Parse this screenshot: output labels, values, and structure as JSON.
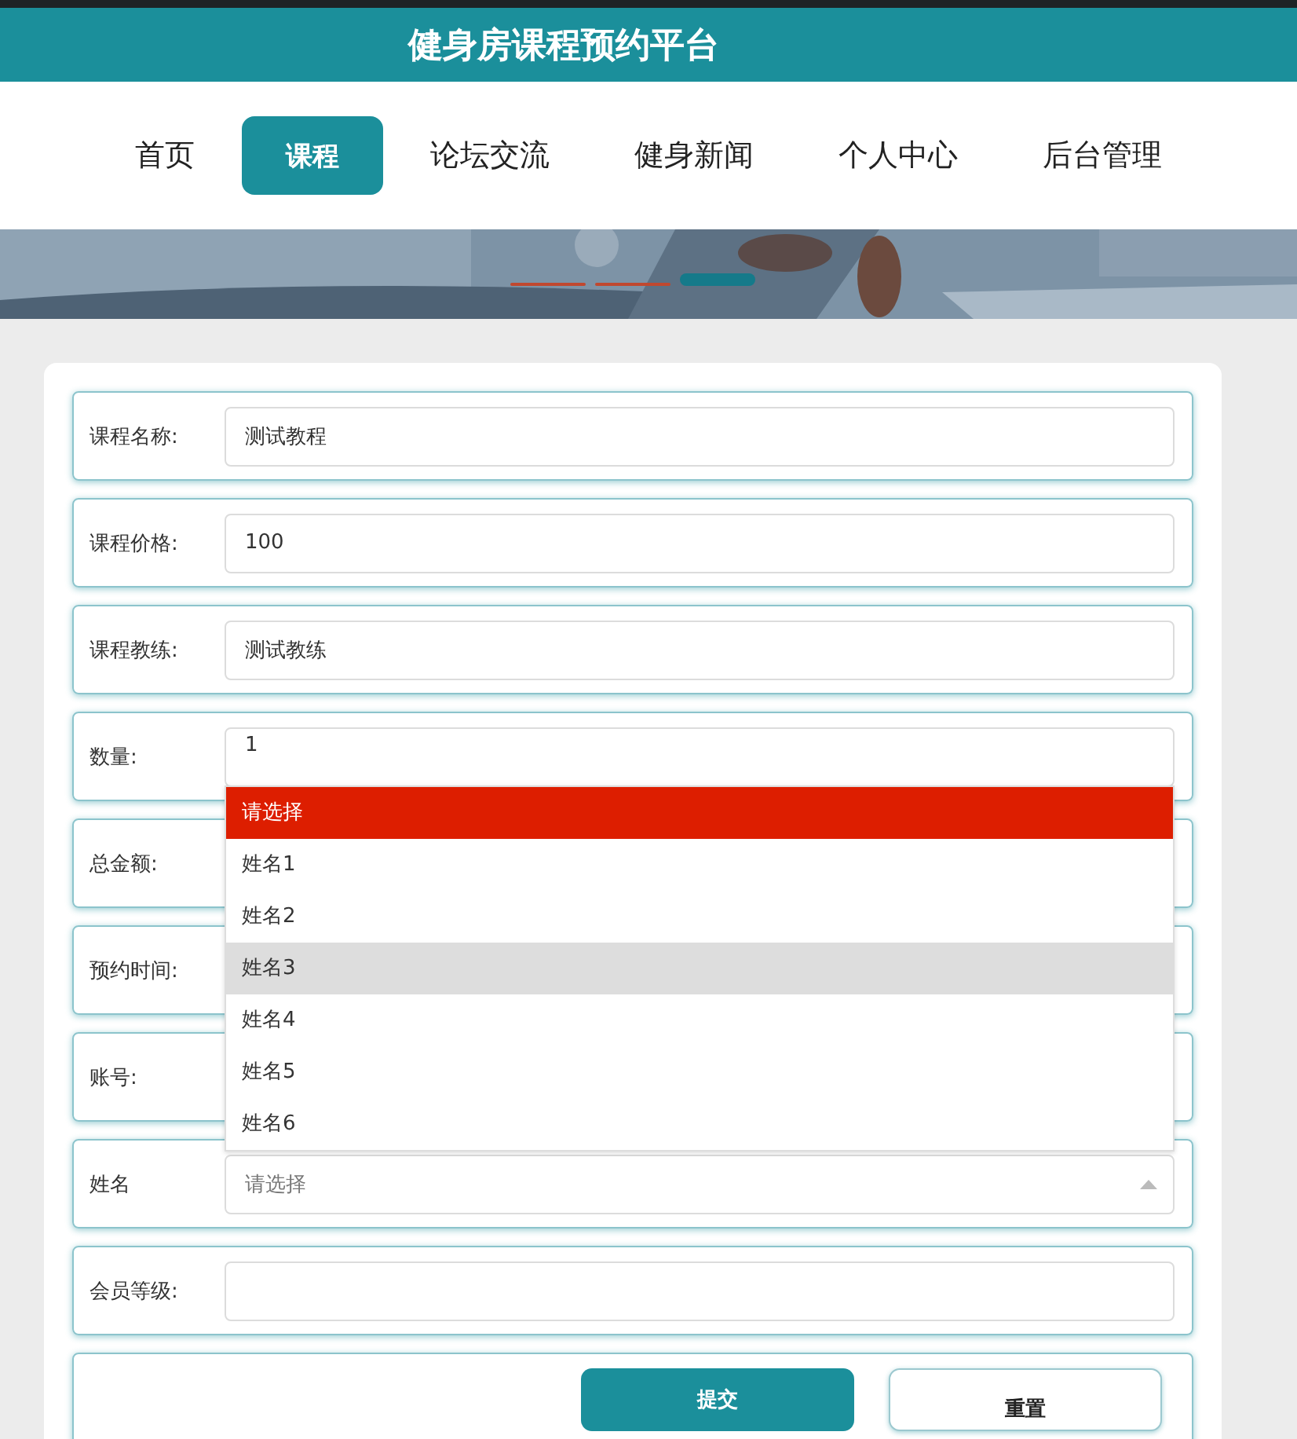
{
  "header": {
    "title": "健身房课程预约平台"
  },
  "nav": [
    {
      "label": "首页",
      "selected": false
    },
    {
      "label": "课程",
      "selected": true
    },
    {
      "label": "论坛交流",
      "selected": false
    },
    {
      "label": "健身新闻",
      "selected": false
    },
    {
      "label": "个人中心",
      "selected": false
    },
    {
      "label": "后台管理",
      "selected": false
    }
  ],
  "banner": {
    "kind": "picture",
    "indicators": [
      {
        "selected": false
      },
      {
        "selected": false
      },
      {
        "selected": true
      }
    ]
  },
  "form": {
    "fields": [
      {
        "kind": "text",
        "label": "课程名称:",
        "value": "测试教程"
      },
      {
        "kind": "text",
        "label": "课程价格:",
        "value": "100"
      },
      {
        "kind": "text",
        "label": "课程教练:",
        "value": "测试教练"
      },
      {
        "kind": "text",
        "label": "数量:",
        "value": "1"
      },
      {
        "kind": "label",
        "label": "总金额:"
      },
      {
        "kind": "label",
        "label": "预约时间:"
      },
      {
        "kind": "label",
        "label": "账号:"
      },
      {
        "kind": "select",
        "label": "姓名",
        "placeholder": "请选择",
        "expanded": true,
        "options": [
          {
            "label": "请选择",
            "selected": true,
            "hovered": false
          },
          {
            "label": "姓名1",
            "selected": false,
            "hovered": false
          },
          {
            "label": "姓名2",
            "selected": false,
            "hovered": false
          },
          {
            "label": "姓名3",
            "selected": false,
            "hovered": true
          },
          {
            "label": "姓名4",
            "selected": false,
            "hovered": false
          },
          {
            "label": "姓名5",
            "selected": false,
            "hovered": false
          },
          {
            "label": "姓名6",
            "selected": false,
            "hovered": false
          }
        ]
      },
      {
        "kind": "text",
        "label": "会员等级:"
      }
    ],
    "buttons": [
      {
        "kind": "primary",
        "label": "提交"
      },
      {
        "kind": "secondary",
        "label": "重置"
      }
    ]
  }
}
